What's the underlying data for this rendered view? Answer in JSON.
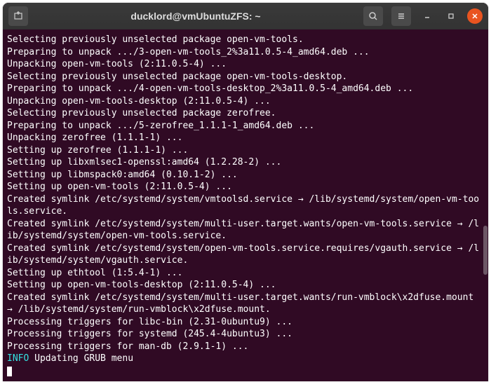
{
  "titlebar": {
    "title": "ducklord@vmUbuntuZFS: ~"
  },
  "terminal": {
    "lines": [
      "Selecting previously unselected package open-vm-tools.",
      "Preparing to unpack .../3-open-vm-tools_2%3a11.0.5-4_amd64.deb ...",
      "Unpacking open-vm-tools (2:11.0.5-4) ...",
      "Selecting previously unselected package open-vm-tools-desktop.",
      "Preparing to unpack .../4-open-vm-tools-desktop_2%3a11.0.5-4_amd64.deb ...",
      "Unpacking open-vm-tools-desktop (2:11.0.5-4) ...",
      "Selecting previously unselected package zerofree.",
      "Preparing to unpack .../5-zerofree_1.1.1-1_amd64.deb ...",
      "Unpacking zerofree (1.1.1-1) ...",
      "Setting up zerofree (1.1.1-1) ...",
      "Setting up libxmlsec1-openssl:amd64 (1.2.28-2) ...",
      "Setting up libmspack0:amd64 (0.10.1-2) ...",
      "Setting up open-vm-tools (2:11.0.5-4) ...",
      "Created symlink /etc/systemd/system/vmtoolsd.service → /lib/systemd/system/open-vm-tools.service.",
      "Created symlink /etc/systemd/system/multi-user.target.wants/open-vm-tools.service → /lib/systemd/system/open-vm-tools.service.",
      "Created symlink /etc/systemd/system/open-vm-tools.service.requires/vgauth.service → /lib/systemd/system/vgauth.service.",
      "Setting up ethtool (1:5.4-1) ...",
      "Setting up open-vm-tools-desktop (2:11.0.5-4) ...",
      "Created symlink /etc/systemd/system/multi-user.target.wants/run-vmblock\\x2dfuse.mount → /lib/systemd/system/run-vmblock\\x2dfuse.mount.",
      "Processing triggers for libc-bin (2.31-0ubuntu9) ...",
      "Processing triggers for systemd (245.4-4ubuntu3) ...",
      "Processing triggers for man-db (2.9.1-1) ..."
    ],
    "info_label": "INFO",
    "info_text": " Updating GRUB menu"
  }
}
